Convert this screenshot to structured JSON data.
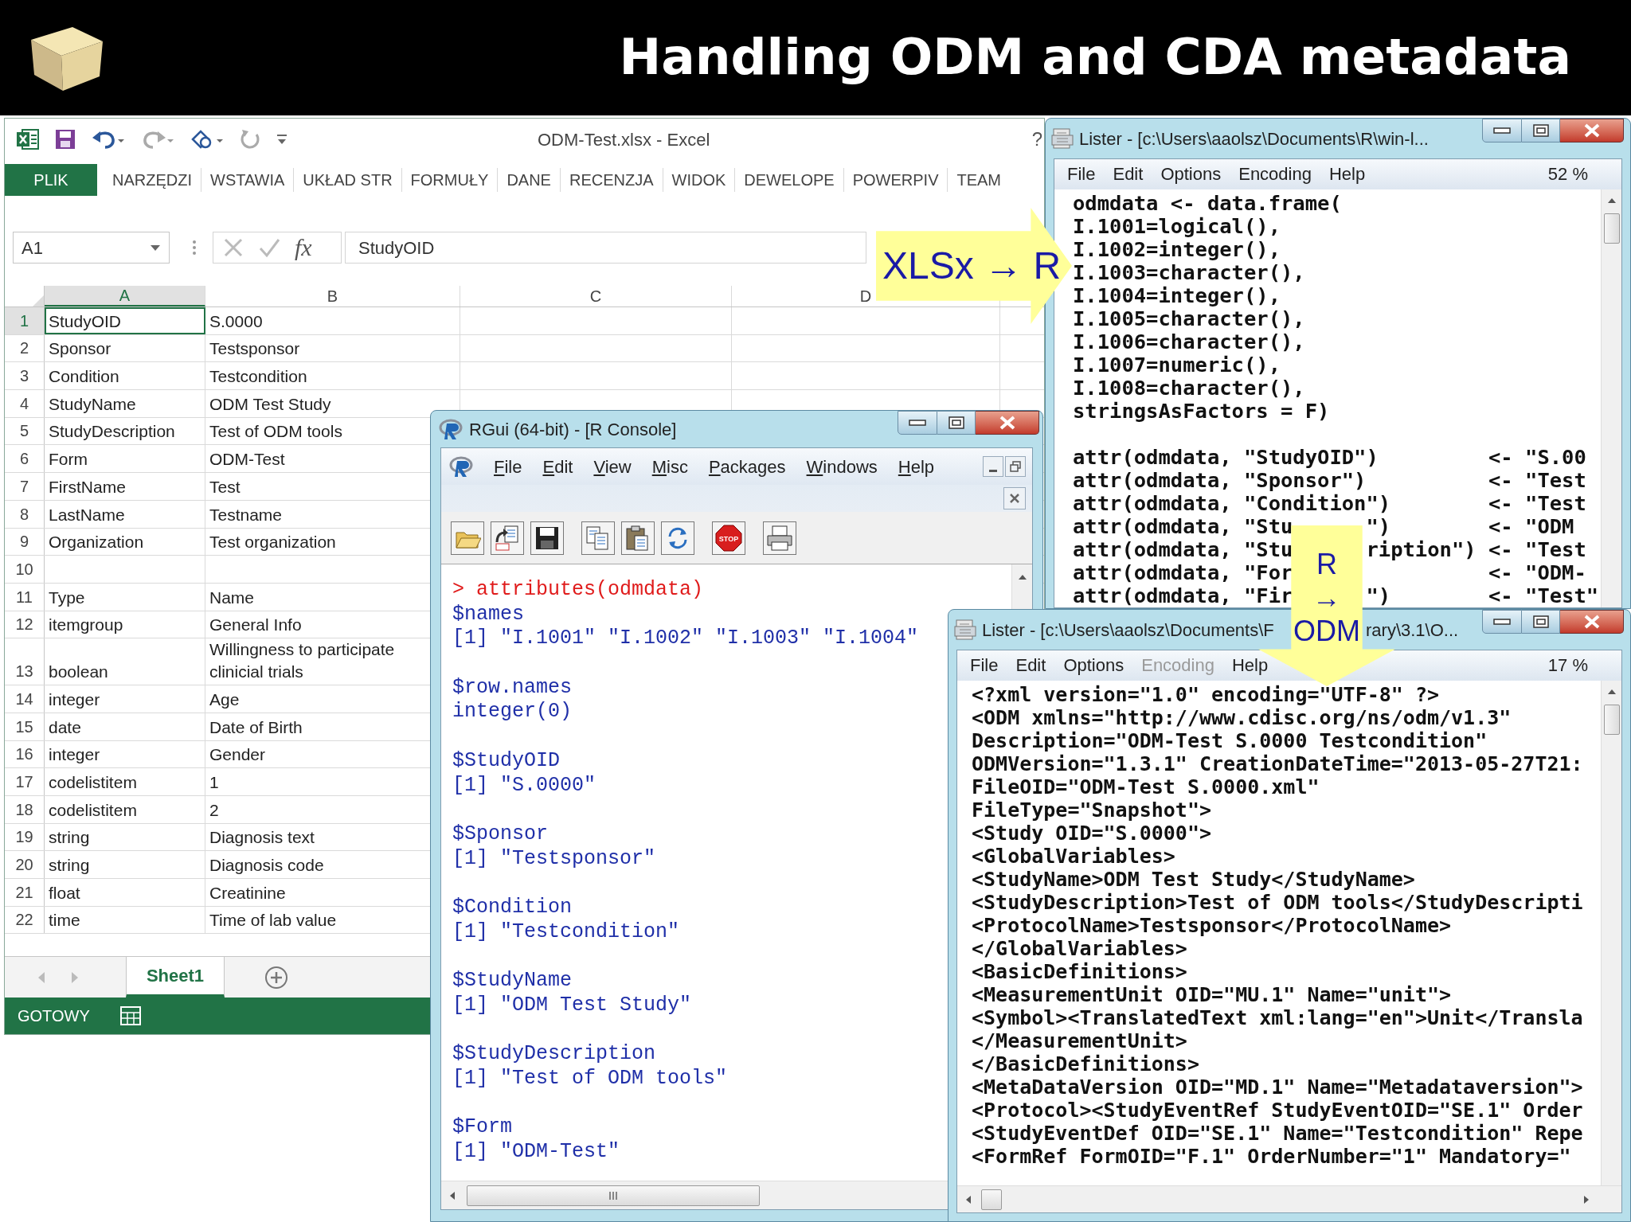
{
  "slide_title": "Handling ODM and CDA metadata",
  "excel": {
    "title": "ODM-Test.xlsx - Excel",
    "help": "?",
    "tabs": [
      {
        "label": "PLIK",
        "kind": "file"
      },
      {
        "label": "NARZĘDZI",
        "kind": "tab"
      },
      {
        "label": "WSTAWIA",
        "kind": "tab"
      },
      {
        "label": "UKŁAD STR",
        "kind": "tab"
      },
      {
        "label": "FORMUŁY",
        "kind": "tab"
      },
      {
        "label": "DANE",
        "kind": "tab"
      },
      {
        "label": "RECENZJA",
        "kind": "tab"
      },
      {
        "label": "WIDOK",
        "kind": "tab"
      },
      {
        "label": "DEWELOPE",
        "kind": "tab"
      },
      {
        "label": "POWERPIV",
        "kind": "tab"
      },
      {
        "label": "TEAM",
        "kind": "tab"
      }
    ],
    "name_box": "A1",
    "fx": "fx",
    "formula": "StudyOID",
    "columns": [
      {
        "label": "A",
        "selected": true
      },
      {
        "label": "B",
        "selected": false
      },
      {
        "label": "C",
        "selected": false
      },
      {
        "label": "D",
        "selected": false
      }
    ],
    "rows": [
      {
        "number": "1",
        "selected": true,
        "cells": [
          "StudyOID",
          "S.0000"
        ]
      },
      {
        "number": "2",
        "selected": false,
        "cells": [
          "Sponsor",
          "Testsponsor"
        ]
      },
      {
        "number": "3",
        "selected": false,
        "cells": [
          "Condition",
          "Testcondition"
        ]
      },
      {
        "number": "4",
        "selected": false,
        "cells": [
          "StudyName",
          "ODM Test Study"
        ]
      },
      {
        "number": "5",
        "selected": false,
        "cells": [
          "StudyDescription",
          "Test of ODM tools"
        ]
      },
      {
        "number": "6",
        "selected": false,
        "cells": [
          "Form",
          "ODM-Test"
        ]
      },
      {
        "number": "7",
        "selected": false,
        "cells": [
          "FirstName",
          "Test"
        ]
      },
      {
        "number": "8",
        "selected": false,
        "cells": [
          "LastName",
          "Testname"
        ]
      },
      {
        "number": "9",
        "selected": false,
        "cells": [
          "Organization",
          "Test organization"
        ]
      },
      {
        "number": "10",
        "selected": false
      },
      {
        "number": "11",
        "selected": false,
        "cells": [
          "Type",
          "Name"
        ]
      },
      {
        "number": "12",
        "selected": false,
        "cells": [
          "itemgroup",
          "General Info"
        ]
      },
      {
        "number": "13",
        "selected": false,
        "cells": [
          "boolean",
          "Willingness to participate clinicial trials"
        ]
      },
      {
        "number": "14",
        "selected": false,
        "cells": [
          "integer",
          "Age"
        ]
      },
      {
        "number": "15",
        "selected": false,
        "cells": [
          "date",
          "Date of Birth"
        ]
      },
      {
        "number": "16",
        "selected": false,
        "cells": [
          "integer",
          "Gender"
        ]
      },
      {
        "number": "17",
        "selected": false,
        "cells": [
          "codelistitem",
          "1"
        ]
      },
      {
        "number": "18",
        "selected": false,
        "cells": [
          "codelistitem",
          "2"
        ]
      },
      {
        "number": "19",
        "selected": false,
        "cells": [
          "string",
          "Diagnosis text"
        ]
      },
      {
        "number": "20",
        "selected": false,
        "cells": [
          "string",
          "Diagnosis code"
        ]
      },
      {
        "number": "21",
        "selected": false,
        "cells": [
          "float",
          "Creatinine"
        ]
      },
      {
        "number": "22",
        "selected": false,
        "cells": [
          "time",
          "Time of lab value"
        ]
      }
    ],
    "sheets": [
      {
        "label": "Sheet1",
        "selected": true
      }
    ],
    "status": "GOTOWY"
  },
  "lister_top": {
    "title": "Lister - [c:\\Users\\aaolsz\\Documents\\R\\win-l...",
    "menu": [
      {
        "label": "File",
        "disabled": false
      },
      {
        "label": "Edit",
        "disabled": false
      },
      {
        "label": "Options",
        "disabled": false
      },
      {
        "label": "Encoding",
        "disabled": false
      },
      {
        "label": "Help",
        "disabled": false
      }
    ],
    "zoom": "52 %",
    "code": [
      "odmdata <- data.frame(",
      "I.1001=logical(),",
      "I.1002=integer(),",
      "I.1003=character(),",
      "I.1004=integer(),",
      "I.1005=character(),",
      "I.1006=character(),",
      "I.1007=numeric(),",
      "I.1008=character(),",
      "stringsAsFactors = F)"
    ],
    "attrs": [
      {
        "target": "attr(odmdata, \"StudyOID\")",
        "value": "<- \"S.00"
      },
      {
        "target": "attr(odmdata, \"Sponsor\")",
        "value": "<- \"Test"
      },
      {
        "target": "attr(odmdata, \"Condition\")",
        "value": "<- \"Test"
      },
      {
        "target": "attr(odmdata, \"Stu",
        "tail": "\")",
        "value": "<- \"ODM"
      },
      {
        "target": "attr(odmdata, \"Stu",
        "tail": "ription\")",
        "value": "<- \"Test"
      },
      {
        "target": "attr(odmdata, \"For",
        "value": "<- \"ODM-"
      },
      {
        "target": "attr(odmdata, \"Fir",
        "tail": "\")",
        "value": "<- \"Test\""
      }
    ]
  },
  "rgui": {
    "title": "RGui (64-bit) - [R Console]",
    "menu": [
      "File",
      "Edit",
      "View",
      "Misc",
      "Packages",
      "Windows",
      "Help"
    ],
    "stop_label": "STOP",
    "blocks": [
      [
        {
          "kind": "input",
          "text": "> attributes(odmdata)"
        },
        {
          "kind": "output",
          "text": "$names"
        },
        {
          "kind": "output",
          "text": "[1] \"I.1001\" \"I.1002\" \"I.1003\" \"I.1004\""
        }
      ],
      [
        {
          "kind": "output",
          "text": "$row.names"
        },
        {
          "kind": "output",
          "text": "integer(0)"
        }
      ],
      [
        {
          "kind": "output",
          "text": "$StudyOID"
        },
        {
          "kind": "output",
          "text": "[1] \"S.0000\""
        }
      ],
      [
        {
          "kind": "output",
          "text": "$Sponsor"
        },
        {
          "kind": "output",
          "text": "[1] \"Testsponsor\""
        }
      ],
      [
        {
          "kind": "output",
          "text": "$Condition"
        },
        {
          "kind": "output",
          "text": "[1] \"Testcondition\""
        }
      ],
      [
        {
          "kind": "output",
          "text": "$StudyName"
        },
        {
          "kind": "output",
          "text": "[1] \"ODM Test Study\""
        }
      ],
      [
        {
          "kind": "output",
          "text": "$StudyDescription"
        },
        {
          "kind": "output",
          "text": "[1] \"Test of ODM tools\""
        }
      ],
      [
        {
          "kind": "output",
          "text": "$Form"
        },
        {
          "kind": "output",
          "text": "[1] \"ODM-Test\""
        }
      ]
    ]
  },
  "lister_bottom": {
    "title_parts": [
      "Lister - [c:\\Users\\aaolsz\\Documents\\F",
      "rary\\3.1\\O..."
    ],
    "menu": [
      {
        "label": "File",
        "disabled": false
      },
      {
        "label": "Edit",
        "disabled": false
      },
      {
        "label": "Options",
        "disabled": false
      },
      {
        "label": "Encoding",
        "disabled": true
      },
      {
        "label": "Help",
        "disabled": false
      }
    ],
    "zoom": "17 %",
    "lines": [
      "<?xml version=\"1.0\" encoding=\"UTF-8\" ?>",
      "<ODM xmlns=\"http://www.cdisc.org/ns/odm/v1.3\"",
      "Description=\"ODM-Test S.0000 Testcondition\"",
      "ODMVersion=\"1.3.1\" CreationDateTime=\"2013-05-27T21:",
      "FileOID=\"ODM-Test S.0000.xml\"",
      "FileType=\"Snapshot\">",
      "<Study OID=\"S.0000\">",
      "<GlobalVariables>",
      "<StudyName>ODM Test Study</StudyName>",
      "<StudyDescription>Test of ODM tools</StudyDescripti",
      "<ProtocolName>Testsponsor</ProtocolName>",
      "</GlobalVariables>",
      "<BasicDefinitions>",
      "<MeasurementUnit OID=\"MU.1\" Name=\"unit\">",
      "<Symbol><TranslatedText xml:lang=\"en\">Unit</Transla",
      "</MeasurementUnit>",
      "</BasicDefinitions>",
      "<MetaDataVersion OID=\"MD.1\" Name=\"Metadataversion\">",
      "<Protocol><StudyEventRef StudyEventOID=\"SE.1\" Order",
      "<StudyEventDef OID=\"SE.1\" Name=\"Testcondition\" Repe",
      "<FormRef FormOID=\"F.1\" OrderNumber=\"1\" Mandatory=\""
    ]
  },
  "arrows": [
    {
      "kind": "right",
      "parts": [
        "XLSx → R"
      ]
    },
    {
      "kind": "down",
      "parts": [
        "R",
        "→",
        "ODM"
      ]
    }
  ]
}
